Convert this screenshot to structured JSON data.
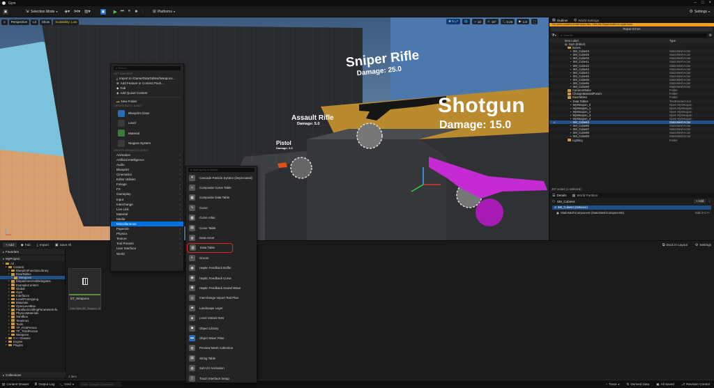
{
  "title": {
    "app": "Gym"
  },
  "toolbar": {
    "selection_mode": "Selection Mode",
    "platforms": "Platforms",
    "settings": "Settings"
  },
  "viewport": {
    "perspective": "Perspective",
    "lit": "Lit",
    "show": "Show",
    "scalability": "Scalability: Low",
    "grid_snap": "10",
    "rot_snap": "10°",
    "scale_snap": "0.25",
    "cam_speed": "1.0",
    "signs": {
      "sniper": "Sniper Rifle",
      "sniper_dmg": "Damage: 25.0",
      "shotgun": "Shotgun",
      "shotgun_dmg": "Damage: 15.0",
      "assault": "Assault Rifle",
      "assault_dmg": "Damage: 5.0",
      "pistol": "Pistol",
      "pistol_dmg": "Damage: 2.0"
    }
  },
  "outliner": {
    "tab": "Outliner",
    "tab2": "World Settings",
    "warning": "The world contains invalid actor files. Click the Repair button to repair them.",
    "repair": "Repair Errors",
    "search_placeholder": "Search",
    "col_label": "Item Label",
    "col_type": "Type",
    "rows": [
      {
        "label": "Gym (Editor)",
        "type": "",
        "indent": 2,
        "kind": "world"
      },
      {
        "label": "Boxes",
        "type": "",
        "indent": 3,
        "kind": "folder"
      },
      {
        "label": "SM_Cube24",
        "type": "StaticMeshActor",
        "indent": 4,
        "kind": "mesh"
      },
      {
        "label": "SM_Cube25",
        "type": "StaticMeshActor",
        "indent": 4,
        "kind": "mesh"
      },
      {
        "label": "SM_Cube33",
        "type": "StaticMeshActor",
        "indent": 4,
        "kind": "mesh"
      },
      {
        "label": "SM_Cube41",
        "type": "StaticMeshActor",
        "indent": 4,
        "kind": "mesh"
      },
      {
        "label": "SM_Cube42",
        "type": "StaticMeshActor",
        "indent": 4,
        "kind": "mesh"
      },
      {
        "label": "SM_Cube43",
        "type": "StaticMeshActor",
        "indent": 4,
        "kind": "mesh"
      },
      {
        "label": "SM_Cube44",
        "type": "StaticMeshActor",
        "indent": 4,
        "kind": "mesh"
      },
      {
        "label": "SM_Cube45",
        "type": "StaticMeshActor",
        "indent": 4,
        "kind": "mesh"
      },
      {
        "label": "SM_Cube46",
        "type": "StaticMeshActor",
        "indent": 4,
        "kind": "mesh"
      },
      {
        "label": "SM_Cube65",
        "type": "StaticMeshActor",
        "indent": 4,
        "kind": "mesh"
      },
      {
        "label": "SM_Cube66",
        "type": "StaticMeshActor",
        "indent": 4,
        "kind": "mesh"
      },
      {
        "label": "CameraShake",
        "type": "Folder",
        "indent": 3,
        "kind": "folder"
      },
      {
        "label": "ChangeMaterialParam",
        "type": "Folder",
        "indent": 3,
        "kind": "folder"
      },
      {
        "label": "DataTables",
        "type": "Folder",
        "indent": 3,
        "kind": "folder"
      },
      {
        "label": "Data Tables",
        "type": "TextRenderActor",
        "indent": 4,
        "kind": "mesh"
      },
      {
        "label": "MyWeapon_0",
        "type": "Open MyWeapon",
        "indent": 4,
        "kind": "mesh"
      },
      {
        "label": "MyWeapon_1",
        "type": "Open MyWeapon",
        "indent": 4,
        "kind": "mesh"
      },
      {
        "label": "MyWeapon_2",
        "type": "Open MyWeapon",
        "indent": 4,
        "kind": "mesh"
      },
      {
        "label": "MyWeapon_3",
        "type": "Open MyWeapon",
        "indent": 4,
        "kind": "mesh"
      },
      {
        "label": "MyWeapon_4",
        "type": "Open MyWeapon",
        "indent": 4,
        "kind": "mesh"
      },
      {
        "label": "SM_Cube64",
        "type": "StaticMeshActor",
        "indent": 4,
        "kind": "mesh",
        "selected": true
      },
      {
        "label": "SM_Cube65",
        "type": "StaticMeshActor",
        "indent": 4,
        "kind": "mesh"
      },
      {
        "label": "SM_Cube67",
        "type": "StaticMeshActor",
        "indent": 4,
        "kind": "mesh"
      },
      {
        "label": "SM_Cube68",
        "type": "StaticMeshActor",
        "indent": 4,
        "kind": "mesh"
      },
      {
        "label": "SM_Cube69",
        "type": "StaticMeshActor",
        "indent": 4,
        "kind": "mesh"
      },
      {
        "label": "Lighting",
        "type": "Folder",
        "indent": 3,
        "kind": "folder"
      }
    ],
    "footer": "207 actors (1 selected)"
  },
  "details": {
    "tab": "Details",
    "tab2": "World Partition",
    "actor": "SM_Cube64",
    "add": "+ Add",
    "instance": "SM_Cube64 (Instance)",
    "component": "StaticMeshComponent (StaticMeshComponent0)",
    "edit_cpp": "Edit in C++"
  },
  "drawer": {
    "add": "+ Add",
    "fab": "Fab",
    "import": "Import",
    "save_all": "Save All",
    "dock": "Dock in Layout",
    "settings": "Settings",
    "favorites": "Favorites",
    "project": "MyProject",
    "collections": "Collections",
    "items_count": "1 item",
    "asset_name": "DT_Weapons",
    "asset_sub": "Data Table (BP_Weapons_St...",
    "tree": [
      {
        "label": "All",
        "indent": 0
      },
      {
        "label": "Content",
        "indent": 1
      },
      {
        "label": "BlueprintFunctionLibrary",
        "indent": 2
      },
      {
        "label": "DataTables",
        "indent": 2
      },
      {
        "label": "Weapons",
        "indent": 3,
        "selected": true
      },
      {
        "label": "DispatchersAndDelegates",
        "indent": 2
      },
      {
        "label": "ExampleContent",
        "indent": 2
      },
      {
        "label": "Global",
        "indent": 2
      },
      {
        "label": "Gym",
        "indent": 2
      },
      {
        "label": "Interfaces",
        "indent": 2
      },
      {
        "label": "LevelPrototyping",
        "indent": 2
      },
      {
        "label": "Materials",
        "indent": 2
      },
      {
        "label": "OpenLevelBox",
        "indent": 2
      },
      {
        "label": "ParallaxScrollingParameterInfo",
        "indent": 2
      },
      {
        "label": "PhysicsMaterials",
        "indent": 2
      },
      {
        "label": "Sandbox",
        "indent": 2
      },
      {
        "label": "Timelines",
        "indent": 2
      },
      {
        "label": "Tools",
        "indent": 2
      },
      {
        "label": "TP_FirstPerson",
        "indent": 2
      },
      {
        "label": "TP_ThirdPerson",
        "indent": 2
      },
      {
        "label": "Weapons",
        "indent": 2
      },
      {
        "label": "C++ Classes",
        "indent": 1
      },
      {
        "label": "Engine",
        "indent": 1
      },
      {
        "label": "Plugins",
        "indent": 1
      }
    ]
  },
  "context_menu": {
    "search_placeholder": "Search",
    "head_folder": "GET CONTENT",
    "import_item": "Import to /Game/DataTables/Weapons...",
    "add_feature": "Add Feature or Content Pack...",
    "fab": "Fab",
    "add_quixel": "Add Quixel Content",
    "new_folder": "New Folder",
    "head_basic": "CREATE BASIC ASSET",
    "head_advanced": "CREATE ADVANCED ASSET",
    "basic": [
      {
        "label": "Blueprint Class",
        "color": "#2a6bb5"
      },
      {
        "label": "Level",
        "color": "#3a3a3a"
      },
      {
        "label": "Material",
        "color": "#3b7a3b"
      },
      {
        "label": "Niagara System",
        "color": "#3a3a3a"
      }
    ],
    "advanced": [
      "Animation",
      "Artificial Intelligence",
      "Audio",
      "Blueprint",
      "Cinematics",
      "Editor Utilities",
      "Foliage",
      "FX",
      "Gameplay",
      "Input",
      "Interchange",
      "Live Link",
      "Material",
      "Media",
      "Miscellaneous",
      "Paper2D",
      "Physics",
      "Texture",
      "Tool Presets",
      "User Interface",
      "World"
    ],
    "highlighted": "Miscellaneous"
  },
  "submenu": {
    "search_placeholder": "Start typing to search",
    "items": [
      {
        "label": "Cascade Particle System (Deprecated)",
        "color": "#555555",
        "glyph": "✦"
      },
      {
        "label": "Composite Curve Table",
        "color": "#555555",
        "glyph": "≈"
      },
      {
        "label": "Composite Data Table",
        "color": "#555555",
        "glyph": "▦"
      },
      {
        "label": "Curve",
        "color": "#555555",
        "glyph": "∿"
      },
      {
        "label": "Curve Atlas",
        "color": "#555555",
        "glyph": "▩"
      },
      {
        "label": "Curve Table",
        "color": "#555555",
        "glyph": "▤"
      },
      {
        "label": "Data Asset",
        "color": "#555555",
        "glyph": "◍"
      },
      {
        "label": "Data Table",
        "color": "#555555",
        "glyph": "▥"
      },
      {
        "label": "Groom",
        "color": "#555555",
        "glyph": "◐"
      },
      {
        "label": "Haptic Feedback Buffer",
        "color": "#555555",
        "glyph": "◉"
      },
      {
        "label": "Haptic Feedback Curve",
        "color": "#555555",
        "glyph": "◉"
      },
      {
        "label": "Haptic Feedback Sound Wave",
        "color": "#555555",
        "glyph": "◉"
      },
      {
        "label": "Interchange Import Test Plan",
        "color": "#555555",
        "glyph": "◎"
      },
      {
        "label": "Landscape Layer",
        "color": "#555555",
        "glyph": "▰"
      },
      {
        "label": "Level Variant Sets",
        "color": "#555555",
        "glyph": "◈"
      },
      {
        "label": "Object Library",
        "color": "#555555",
        "glyph": "◆"
      },
      {
        "label": "Object Mixer Filter",
        "color": "#2a6bb5",
        "glyph": "▬"
      },
      {
        "label": "Preview Mesh Collection",
        "color": "#555555",
        "glyph": "◍"
      },
      {
        "label": "String Table",
        "color": "#555555",
        "glyph": "▤"
      },
      {
        "label": "Sub UV Animation",
        "color": "#555555",
        "glyph": "◍"
      },
      {
        "label": "Touch Interface Setup",
        "color": "#555555",
        "glyph": "▯"
      }
    ],
    "highlight_color": "#e0261f"
  },
  "status": {
    "content_drawer": "Content Drawer",
    "output_log": "Output Log",
    "cmd": "Cmd",
    "cmd_placeholder": "Enter Console Command",
    "trace": "Trace",
    "derived_data": "Derived Data",
    "all_saved": "All Saved",
    "revision": "Revision Control"
  },
  "colors": {
    "accent": "#0070e0",
    "selection": "#1f4f86",
    "play_green": "#4ec24e",
    "magenta": "#c42bd3"
  }
}
